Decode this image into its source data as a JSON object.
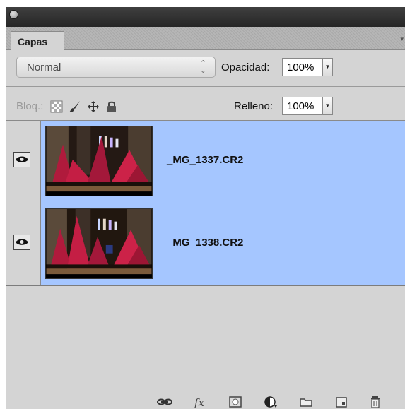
{
  "panel": {
    "tab_label": "Capas"
  },
  "blend": {
    "mode": "Normal",
    "opacity_label": "Opacidad:",
    "opacity_value": "100%"
  },
  "lock": {
    "label": "Bloq.:",
    "fill_label": "Relleno:",
    "fill_value": "100%"
  },
  "layers": [
    {
      "name": "_MG_1337.CR2",
      "visible": true,
      "selected": true
    },
    {
      "name": "_MG_1338.CR2",
      "visible": true,
      "selected": true
    }
  ],
  "colors": {
    "selection": "#a5c6ff",
    "panel_bg": "#d4d4d4",
    "titlebar": "#2e2e2e",
    "photo_red": "#b01a3c"
  },
  "footer_icons": [
    "link-layers-icon",
    "fx-icon",
    "layer-mask-icon",
    "adjustment-layer-icon",
    "group-folder-icon",
    "new-layer-icon",
    "trash-icon"
  ]
}
